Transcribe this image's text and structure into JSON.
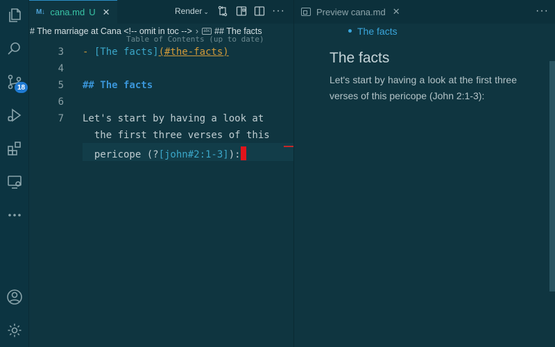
{
  "activity_bar": {
    "items": [
      {
        "name": "explorer",
        "icon": "files-icon"
      },
      {
        "name": "search",
        "icon": "search-icon"
      },
      {
        "name": "source-control",
        "icon": "source-control-icon",
        "badge": "18"
      },
      {
        "name": "run-debug",
        "icon": "run-debug-icon"
      },
      {
        "name": "extensions",
        "icon": "extensions-icon"
      },
      {
        "name": "remote-explorer",
        "icon": "remote-explorer-icon"
      },
      {
        "name": "more",
        "icon": "ellipsis-icon"
      }
    ],
    "bottom": [
      {
        "name": "accounts",
        "icon": "account-icon"
      },
      {
        "name": "manage",
        "icon": "gear-icon"
      }
    ]
  },
  "editor": {
    "tab": {
      "icon_label": "M↓",
      "name": "cana.md",
      "status": "U",
      "close": "✕"
    },
    "toolbar": {
      "render_label": "Render",
      "more": "···"
    },
    "breadcrumb": {
      "items": [
        "# The marriage at Cana <!-- omit in toc -->",
        "## The facts"
      ],
      "separator": "›",
      "symbol_label": "abc"
    },
    "sticky_ghost": "Table of Contents (up to date)",
    "lines": [
      {
        "number": "3",
        "dash": "- ",
        "link_text": "[The facts]",
        "link_url": "(#the-facts)"
      },
      {
        "number": "4"
      },
      {
        "number": "5",
        "heading": "## The facts"
      },
      {
        "number": "6"
      },
      {
        "number": "7",
        "text_1": "Let's start by having a look at",
        "text_2": "  the first three verses of this",
        "text_3_pre": "  pericope (?",
        "text_3_ref": "[john#2:1-3]",
        "text_3_post": "):"
      }
    ]
  },
  "preview": {
    "tab": {
      "name": "Preview cana.md",
      "close": "✕"
    },
    "more": "···",
    "toc_link": "The facts",
    "heading": "The facts",
    "paragraph": "Let's start by having a look at the first three verses of this pericope (John 2:1-3):"
  },
  "colors": {
    "background": "#0f3540",
    "accent": "#3aa6dc",
    "badge": "#1f7ad1",
    "cursor": "#e0141b"
  }
}
